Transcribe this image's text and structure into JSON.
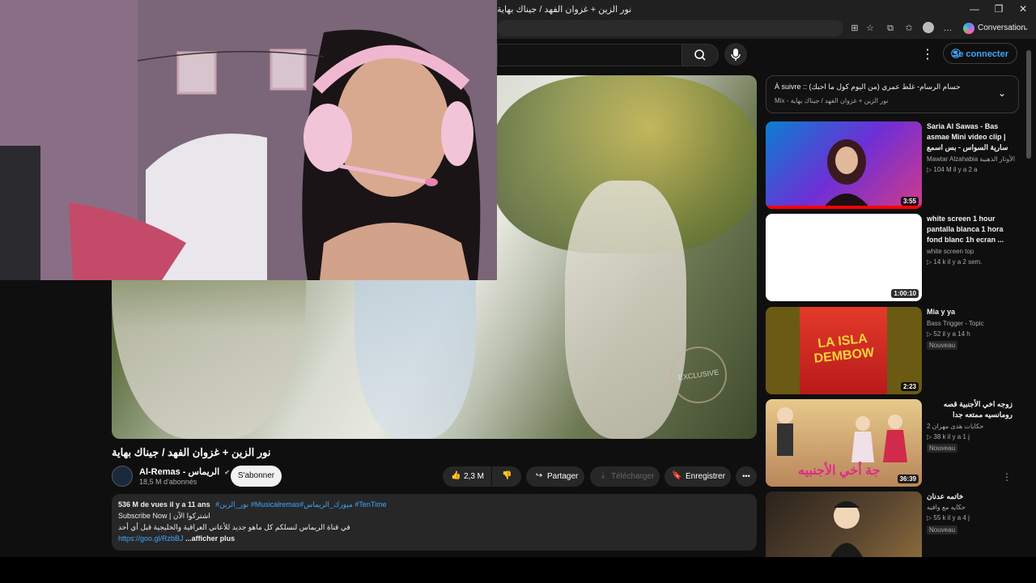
{
  "window": {
    "title": "نور الزين + غزوان الفهد / جيناك بهاية",
    "minimize": "—",
    "restore": "❐",
    "close": "✕"
  },
  "toolbar": {
    "conversation_label": "Conversation"
  },
  "header": {
    "sign_in_label": "Se connecter",
    "more_icon": "⋮"
  },
  "video": {
    "title": "نور الزين + غزوان الفهد / جيناك بهاية",
    "watermark": "EXCLUSIVE",
    "channel_name": "Al-Remas - الريماس",
    "verified": "✔",
    "subscribers": "18,5 M d'abonnés",
    "subscribe_label": "S'abonner",
    "likes": "2,3 M",
    "share_label": "Partager",
    "download_label": "Télécharger",
    "save_label": "Enregistrer",
    "more_label": "•••"
  },
  "description": {
    "stats": "536 M de vues  il y a 11 ans",
    "tags": "#نور_الزين #Musicalremas#ميوزك_الريماس #TenTime",
    "line2": "Subscribe Now | اشتركوا الآن",
    "line3": "في قناة الريماس لنسلكم كل ماهو جديد للأعاني العراقية والخليجية قبل أي أحد",
    "link": "https://goo.gl/RzbBJ",
    "show_more": "...afficher plus"
  },
  "up_next": {
    "label": "À suivre :: حسام الرسام- غلط عمري (من اليوم كول ما احبك)",
    "sub": "Mix - نور الزين + غزوان الفهد / جيناك بهاية"
  },
  "recommendations": [
    {
      "title": "Saria Al Sawas - Bas asmae Mini video clip | سارية السواس - بس اسمع مني فيديو",
      "channel": "Mawtar Alzahabia الأوتار الذهبية",
      "meta": "▷ 104 M  il y a 2 a",
      "duration": "3:55",
      "badge": ""
    },
    {
      "title": "white screen 1 hour pantalla blanca 1 hora fond blanc 1h  ecran ...",
      "channel": "white screen top",
      "meta": "▷ 14 k  il y a 2 sem.",
      "duration": "1:00:10",
      "badge": ""
    },
    {
      "title": "Mia y ya",
      "channel": "Bass Trigger - Topic",
      "meta": "▷ 52  il y a 14 h",
      "duration": "2:23",
      "badge": "Nouveau"
    },
    {
      "title": "زوجه اخي الأجنبية قصه رومانسيه ممتعه جدا",
      "channel": "حكايات هدى مهران 2",
      "meta": "▷ 38 k  il y a 1 j",
      "duration": "36:39",
      "badge": "Nouveau"
    },
    {
      "title": "خاتمه عدنان",
      "channel": "حكايه مع وافيه",
      "meta": "▷ 55 k  il y a 4 j",
      "duration": "",
      "badge": "Nouveau"
    }
  ],
  "thumb_texts": {
    "isla": "LA ISLA DEMBOW",
    "story": "جة أخي الأجنبيه"
  },
  "colors": {
    "background": "#0f0f0f",
    "link": "#3ea6ff",
    "pill": "#272727"
  }
}
